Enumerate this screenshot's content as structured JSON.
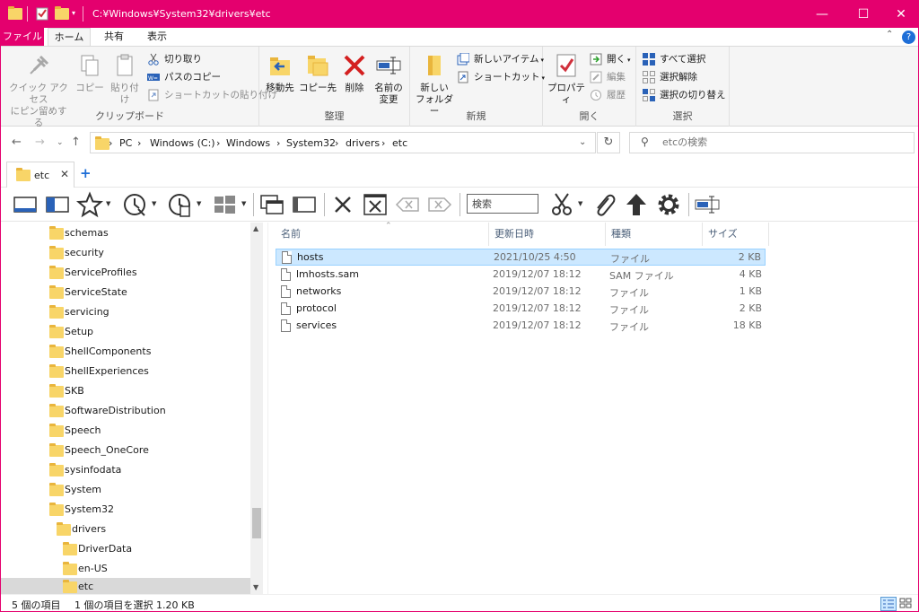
{
  "window": {
    "title": "C:¥Windows¥System32¥drivers¥etc",
    "accent": "#e4006e",
    "minimize": "—",
    "maximize": "☐",
    "close": "✕"
  },
  "ribbon_tabs": {
    "file": "ファイル",
    "home": "ホーム",
    "share": "共有",
    "view": "表示",
    "collapse": "⌃",
    "help": "?"
  },
  "ribbon": {
    "clipboard": {
      "label": "クリップボード",
      "pin_line1": "クイック アクセス",
      "pin_line2": "にピン留めする",
      "copy": "コピー",
      "paste": "貼り付け",
      "cut": "切り取り",
      "copy_path": "パスのコピー",
      "paste_shortcut": "ショートカットの貼り付け"
    },
    "organize": {
      "label": "整理",
      "move_to": "移動先",
      "copy_to": "コピー先",
      "delete": "削除",
      "rename_line1": "名前の",
      "rename_line2": "変更"
    },
    "new": {
      "label": "新規",
      "new_folder_line1": "新しい",
      "new_folder_line2": "フォルダー",
      "new_item": "新しいアイテム",
      "shortcut": "ショートカット"
    },
    "open": {
      "label": "開く",
      "properties": "プロパティ",
      "open": "開く",
      "edit": "編集",
      "history": "履歴"
    },
    "select": {
      "label": "選択",
      "select_all": "すべて選択",
      "select_none": "選択解除",
      "invert": "選択の切り替え"
    }
  },
  "address": {
    "crumbs": [
      "PC",
      "Windows (C:)",
      "Windows",
      "System32",
      "drivers",
      "etc"
    ],
    "separator": "›",
    "search_placeholder": "etcの検索"
  },
  "app_tabs": {
    "current": "etc",
    "close": "✕",
    "add": "+"
  },
  "toolbar": {
    "search_value": "検索"
  },
  "tree": {
    "items": [
      {
        "label": "schemas"
      },
      {
        "label": "security"
      },
      {
        "label": "ServiceProfiles"
      },
      {
        "label": "ServiceState"
      },
      {
        "label": "servicing"
      },
      {
        "label": "Setup"
      },
      {
        "label": "ShellComponents"
      },
      {
        "label": "ShellExperiences"
      },
      {
        "label": "SKB"
      },
      {
        "label": "SoftwareDistribution"
      },
      {
        "label": "Speech"
      },
      {
        "label": "Speech_OneCore"
      },
      {
        "label": "sysinfodata"
      },
      {
        "label": "System"
      },
      {
        "label": "System32"
      },
      {
        "label": "drivers"
      },
      {
        "label": "DriverData"
      },
      {
        "label": "en-US"
      },
      {
        "label": "etc"
      }
    ]
  },
  "columns": {
    "name": "名前",
    "modified": "更新日時",
    "type": "種類",
    "size": "サイズ"
  },
  "files": [
    {
      "name": "hosts",
      "modified": "2021/10/25 4:50",
      "type": "ファイル",
      "size": "2 KB"
    },
    {
      "name": "lmhosts.sam",
      "modified": "2019/12/07 18:12",
      "type": "SAM ファイル",
      "size": "4 KB"
    },
    {
      "name": "networks",
      "modified": "2019/12/07 18:12",
      "type": "ファイル",
      "size": "1 KB"
    },
    {
      "name": "protocol",
      "modified": "2019/12/07 18:12",
      "type": "ファイル",
      "size": "2 KB"
    },
    {
      "name": "services",
      "modified": "2019/12/07 18:12",
      "type": "ファイル",
      "size": "18 KB"
    }
  ],
  "status": {
    "count": "5 個の項目",
    "selection": "1 個の項目を選択  1.20 KB"
  }
}
